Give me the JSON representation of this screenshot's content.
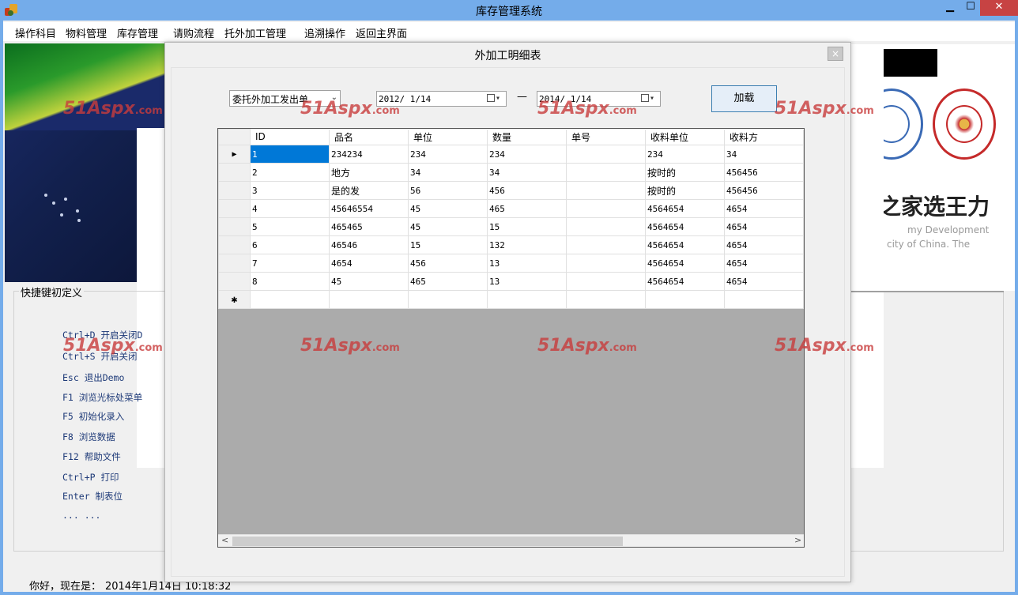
{
  "window": {
    "title": "库存管理系统",
    "minimize": "▁",
    "maximize": "☐",
    "close": "✕"
  },
  "menu": [
    {
      "label": "操作科目"
    },
    {
      "label": "物料管理"
    },
    {
      "label": "库存管理"
    },
    {
      "label": "请购流程"
    },
    {
      "label": "托外加工管理"
    },
    {
      "label": "追溯操作"
    },
    {
      "label": "返回主界面"
    }
  ],
  "shortcuts": {
    "legend": "快捷键初定义",
    "items": [
      "Ctrl+D 开启关闭D",
      "Ctrl+S 开启关闭",
      "Esc 退出Demo",
      "F1 浏览光标处菜单",
      "F5 初始化录入",
      "F8 浏览数据",
      "F12 帮助文件",
      "Ctrl+P 打印",
      "Enter 制表位",
      "... ..."
    ]
  },
  "banner": {
    "text": "之家选王力",
    "sub1": "my Development",
    "sub2": "city of China. The"
  },
  "status": {
    "greeting": "你好，现在是：",
    "datetime": "2014年1月14日 10:18:32"
  },
  "dialog": {
    "title": "外加工明细表",
    "close": "×",
    "type_select": "委托外加工发出单",
    "date_from": "2012/ 1/14",
    "date_to": "2014/ 1/14",
    "dash": "—",
    "load_button": "加载"
  },
  "grid": {
    "columns": [
      "ID",
      "品名",
      "单位",
      "数量",
      "单号",
      "收料单位",
      "收料方"
    ],
    "rows": [
      [
        "1",
        "234234",
        "234",
        "234",
        "",
        "234",
        "34"
      ],
      [
        "2",
        "地方",
        "34",
        "34",
        "",
        "按时的",
        "456456"
      ],
      [
        "3",
        "是的发",
        "56",
        "456",
        "",
        "按时的",
        "456456"
      ],
      [
        "4",
        "45646554",
        "45",
        "465",
        "",
        "4564654",
        "4654"
      ],
      [
        "5",
        "465465",
        "45",
        "15",
        "",
        "4564654",
        "4654"
      ],
      [
        "6",
        "46546",
        "15",
        "132",
        "",
        "4564654",
        "4654"
      ],
      [
        "7",
        "4654",
        "456",
        "13",
        "",
        "4564654",
        "4654"
      ],
      [
        "8",
        "45",
        "465",
        "13",
        "",
        "4564654",
        "4654"
      ]
    ],
    "new_row_marker": "✱",
    "current_row_marker": "▶"
  },
  "watermark": {
    "brand": "51Aspx",
    "suffix": ".com"
  }
}
